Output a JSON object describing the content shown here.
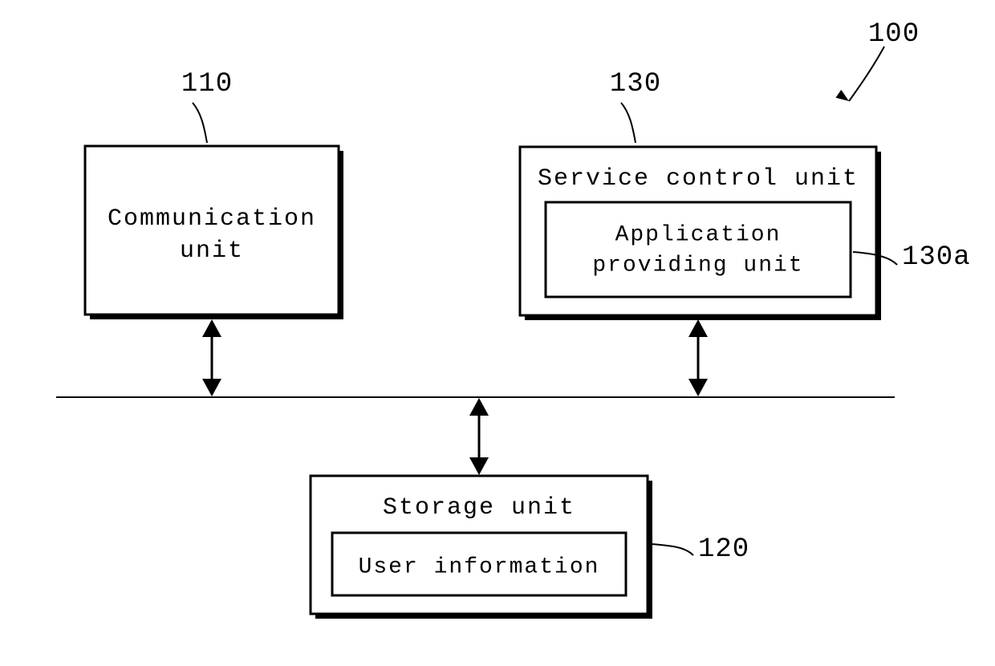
{
  "diagram": {
    "overall_ref": "100",
    "blocks": {
      "communication": {
        "ref": "110",
        "line1": "Communication",
        "line2": "unit"
      },
      "storage": {
        "ref": "120",
        "line1": "Storage unit",
        "inner": "User information"
      },
      "service": {
        "ref": "130",
        "line1": "Service control unit",
        "inner_ref": "130a",
        "inner_line1": "Application",
        "inner_line2": "providing unit"
      }
    }
  }
}
